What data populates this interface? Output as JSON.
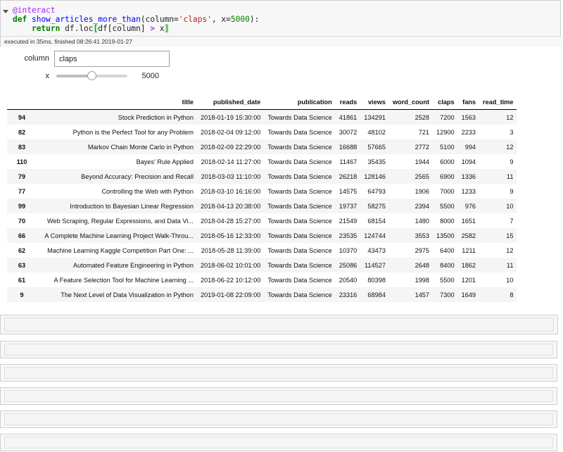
{
  "code": {
    "line1": "@interact",
    "line2": {
      "kw": "def",
      "fn": "show_articles_more_than",
      "open": "(column=",
      "str": "'claps'",
      "mid": ", x=",
      "num": "5000",
      "close": "):"
    },
    "line3": {
      "kw": "return",
      "pre": " df.loc",
      "lb": "[",
      "mid": "df[column] ",
      "op": ">",
      "post": " x",
      "rb": "]"
    }
  },
  "status": "executed in 35ms, finished 08:26:41 2019-01-27",
  "widgets": {
    "column_label": "column",
    "column_value": "claps",
    "x_label": "x",
    "x_value": "5000",
    "x_fraction": 0.5
  },
  "table": {
    "columns": [
      "title",
      "published_date",
      "publication",
      "reads",
      "views",
      "word_count",
      "claps",
      "fans",
      "read_time"
    ],
    "rows": [
      [
        "94",
        "Stock Prediction in Python",
        "2018-01-19 15:30:00",
        "Towards Data Science",
        "41861",
        "134291",
        "2528",
        "7200",
        "1563",
        "12"
      ],
      [
        "82",
        "Python is the Perfect Tool for any Problem",
        "2018-02-04 09:12:00",
        "Towards Data Science",
        "30072",
        "48102",
        "721",
        "12900",
        "2233",
        "3"
      ],
      [
        "83",
        "Markov Chain Monte Carlo in Python",
        "2018-02-09 22:29:00",
        "Towards Data Science",
        "16688",
        "57665",
        "2772",
        "5100",
        "994",
        "12"
      ],
      [
        "110",
        "Bayes' Rule Applied",
        "2018-02-14 11:27:00",
        "Towards Data Science",
        "11467",
        "35435",
        "1944",
        "6000",
        "1094",
        "9"
      ],
      [
        "79",
        "Beyond Accuracy: Precision and Recall",
        "2018-03-03 11:10:00",
        "Towards Data Science",
        "26218",
        "128146",
        "2565",
        "6900",
        "1336",
        "11"
      ],
      [
        "77",
        "Controlling the Web with Python",
        "2018-03-10 16:16:00",
        "Towards Data Science",
        "14575",
        "64793",
        "1906",
        "7000",
        "1233",
        "9"
      ],
      [
        "99",
        "Introduction to Bayesian Linear Regression",
        "2018-04-13 20:38:00",
        "Towards Data Science",
        "19737",
        "58275",
        "2394",
        "5500",
        "976",
        "10"
      ],
      [
        "70",
        "Web Scraping, Regular Expressions, and Data Vi...",
        "2018-04-28 15:27:00",
        "Towards Data Science",
        "21549",
        "68154",
        "1480",
        "8000",
        "1651",
        "7"
      ],
      [
        "66",
        "A Complete Machine Learning Project Walk-Throu...",
        "2018-05-16 12:33:00",
        "Towards Data Science",
        "23535",
        "124744",
        "3553",
        "13500",
        "2582",
        "15"
      ],
      [
        "62",
        "Machine Learning Kaggle Competition Part One: ...",
        "2018-05-28 11:39:00",
        "Towards Data Science",
        "10370",
        "43473",
        "2975",
        "6400",
        "1211",
        "12"
      ],
      [
        "63",
        "Automated Feature Engineering in Python",
        "2018-06-02 10:01:00",
        "Towards Data Science",
        "25086",
        "114527",
        "2648",
        "8400",
        "1862",
        "11"
      ],
      [
        "61",
        "A Feature Selection Tool for Machine Learning ...",
        "2018-06-22 10:12:00",
        "Towards Data Science",
        "20540",
        "80398",
        "1998",
        "5500",
        "1201",
        "10"
      ],
      [
        "9",
        "The Next Level of Data Visualization in Python",
        "2019-01-08 22:09:00",
        "Towards Data Science",
        "23316",
        "68984",
        "1457",
        "7300",
        "1649",
        "8"
      ]
    ]
  },
  "empty_cells": 6
}
